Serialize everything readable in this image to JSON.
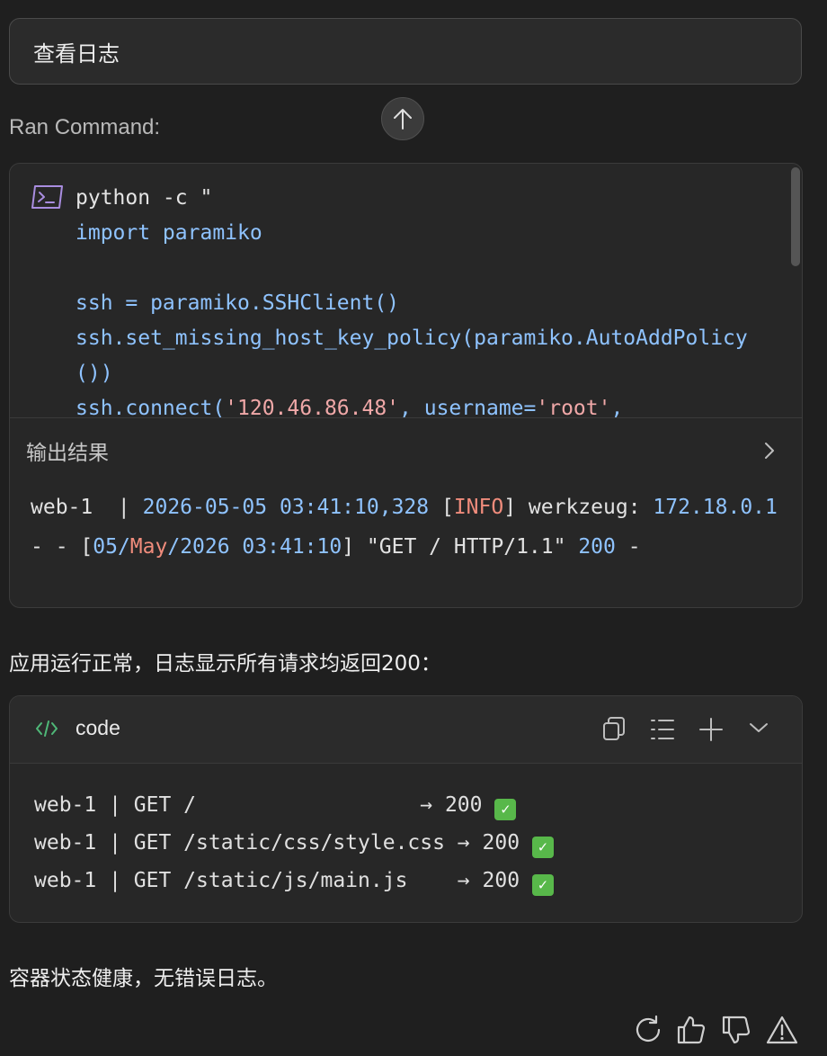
{
  "prompt": {
    "text": "查看日志"
  },
  "ran_command": {
    "label": "Ran Command:",
    "code": {
      "l1": "python -c \"",
      "l2": "import paramiko",
      "l3": "ssh = paramiko.SSHClient()",
      "l4": "ssh.set_missing_host_key_policy(paramiko.AutoAddPolicy",
      "l5": "())",
      "l6_a": "ssh.connect(",
      "l6_b": "'120.46.86.48'",
      "l6_c": ", username=",
      "l6_d": "'root'",
      "l6_e": ","
    },
    "output_label": "输出结果",
    "output": {
      "p1": "web-1  | ",
      "p2": "2026-05-05 03:41:10,328",
      "p3": " [",
      "p4": "INFO",
      "p5": "] werkzeug: ",
      "p6": "172.18.0.1",
      "p7": " - - [",
      "p8": "05/",
      "p9": "May",
      "p10": "/2026 03:41:10",
      "p11": "] \"GET / HTTP/1.1\" ",
      "p12": "200",
      "p13": " -"
    }
  },
  "summary_message": "应用运行正常，日志显示所有请求均返回200：",
  "code_block": {
    "language": "code",
    "lines": [
      {
        "text": "web-1 | GET /                  → 200 ",
        "status": "✓"
      },
      {
        "text": "web-1 | GET /static/css/style.css → 200 ",
        "status": "✓"
      },
      {
        "text": "web-1 | GET /static/js/main.js    → 200 ",
        "status": "✓"
      }
    ]
  },
  "final_message": "容器状态健康，无错误日志。",
  "icons": {
    "scroll_up": "arrow-up-icon",
    "terminal": "terminal-icon",
    "output_expand": "chevron-right-icon",
    "code_tag": "code-tag-icon",
    "copy": "copy-icon",
    "wrap": "list-icon",
    "insert": "plus-icon",
    "collapse": "chevron-down-icon",
    "retry": "refresh-icon",
    "like": "thumbs-up-icon",
    "dislike": "thumbs-down-icon",
    "report": "warning-icon"
  },
  "colors": {
    "accent_blue": "#8fc3ff",
    "accent_red": "#f08c7c",
    "terminal_purple": "#a98de0",
    "check_green": "#58b84a"
  }
}
